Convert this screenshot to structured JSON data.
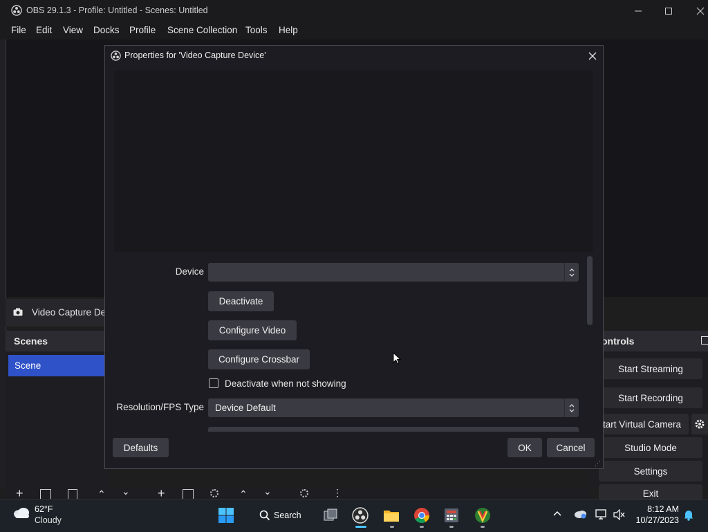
{
  "window": {
    "title": "OBS 29.1.3 - Profile: Untitled - Scenes: Untitled"
  },
  "menu": [
    "File",
    "Edit",
    "View",
    "Docks",
    "Profile",
    "Scene Collection",
    "Tools",
    "Help"
  ],
  "source_item": {
    "label": "Video Capture De"
  },
  "scenes": {
    "header": "Scenes",
    "items": [
      "Scene"
    ]
  },
  "controls": {
    "header": "ontrols",
    "buttons": [
      "Start Streaming",
      "Start Recording",
      "tart Virtual Camera",
      "Studio Mode",
      "Settings",
      "Exit"
    ]
  },
  "dialog": {
    "title": "Properties for 'Video Capture Device'",
    "device_label": "Device",
    "device_value": "",
    "deactivate_button": "Deactivate",
    "configure_video_button": "Configure Video",
    "configure_crossbar_button": "Configure Crossbar",
    "deactivate_when_not_showing": "Deactivate when not showing",
    "deactivate_checked": false,
    "resolution_label": "Resolution/FPS Type",
    "resolution_value": "Device Default",
    "defaults_button": "Defaults",
    "ok_button": "OK",
    "cancel_button": "Cancel"
  },
  "taskbar": {
    "weather_temp": "62°F",
    "weather_desc": "Cloudy",
    "search_label": "Search",
    "time": "8:12 AM",
    "date": "10/27/2023"
  },
  "colors": {
    "accent": "#2f52c8",
    "dialog_bg": "#1c1c22",
    "button_bg": "#3a3a42"
  }
}
